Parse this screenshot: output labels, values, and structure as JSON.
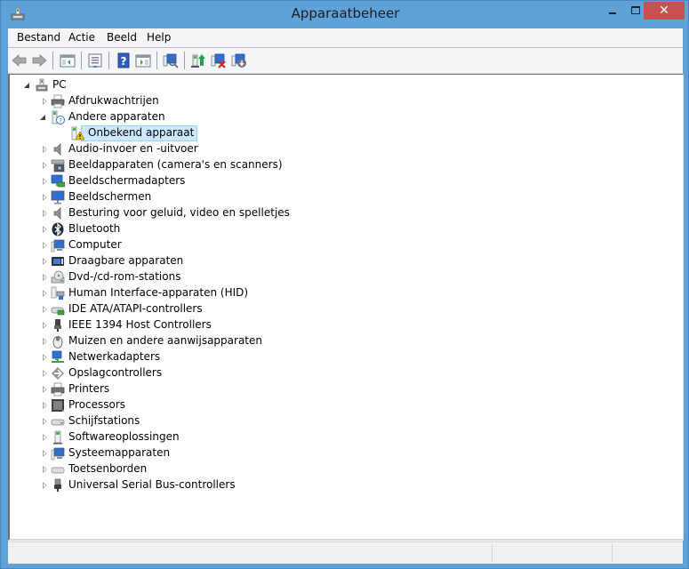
{
  "window": {
    "title": "Apparaatbeheer",
    "close_glyph": "✕",
    "icons": {
      "app": "device-manager-icon",
      "minimize": "minimize-icon",
      "maximize": "maximize-icon",
      "close": "close-icon"
    }
  },
  "menu": {
    "items": [
      {
        "label": "Bestand"
      },
      {
        "label": "Actie"
      },
      {
        "label": "Beeld"
      },
      {
        "label": "Help"
      }
    ]
  },
  "toolbar": {
    "buttons": [
      {
        "name": "back",
        "icon": "back-arrow-icon"
      },
      {
        "name": "forward",
        "icon": "forward-arrow-icon"
      },
      {
        "name": "show-hide-console-tree",
        "icon": "console-tree-icon"
      },
      {
        "name": "properties",
        "icon": "properties-icon"
      },
      {
        "name": "help",
        "icon": "help-icon"
      },
      {
        "name": "show-hide-action-pane",
        "icon": "action-pane-icon"
      },
      {
        "name": "scan-hardware-changes",
        "icon": "scan-hardware-icon"
      },
      {
        "name": "update-driver",
        "icon": "update-driver-icon"
      },
      {
        "name": "uninstall-device",
        "icon": "uninstall-device-icon"
      },
      {
        "name": "enable-device",
        "icon": "enable-device-icon"
      }
    ]
  },
  "tree": {
    "root": {
      "label": "PC",
      "icon": "computer-tower-icon",
      "expanded": true
    },
    "categories": [
      {
        "label": "Afdrukwachtrijen",
        "icon": "print-queue-icon",
        "expanded": false
      },
      {
        "label": "Andere apparaten",
        "icon": "unknown-device-icon",
        "expanded": true,
        "children": [
          {
            "label": "Onbekend apparaat",
            "icon": "warning-device-icon",
            "selected": true
          }
        ]
      },
      {
        "label": "Audio-invoer en -uitvoer",
        "icon": "speaker-icon",
        "expanded": false
      },
      {
        "label": "Beeldapparaten (camera's en scanners)",
        "icon": "camera-scanner-icon",
        "expanded": false
      },
      {
        "label": "Beeldschermadapters",
        "icon": "display-adapter-icon",
        "expanded": false
      },
      {
        "label": "Beeldschermen",
        "icon": "monitor-icon",
        "expanded": false
      },
      {
        "label": "Besturing voor geluid, video en spelletjes",
        "icon": "sound-icon",
        "expanded": false
      },
      {
        "label": "Bluetooth",
        "icon": "bluetooth-icon",
        "expanded": false
      },
      {
        "label": "Computer",
        "icon": "computer-icon",
        "expanded": false
      },
      {
        "label": "Draagbare apparaten",
        "icon": "portable-device-icon",
        "expanded": false
      },
      {
        "label": "Dvd-/cd-rom-stations",
        "icon": "dvd-drive-icon",
        "expanded": false
      },
      {
        "label": "Human Interface-apparaten (HID)",
        "icon": "hid-icon",
        "expanded": false
      },
      {
        "label": "IDE ATA/ATAPI-controllers",
        "icon": "ide-controller-icon",
        "expanded": false
      },
      {
        "label": "IEEE 1394 Host Controllers",
        "icon": "firewire-icon",
        "expanded": false
      },
      {
        "label": "Muizen en andere aanwijsapparaten",
        "icon": "mouse-icon",
        "expanded": false
      },
      {
        "label": "Netwerkadapters",
        "icon": "network-adapter-icon",
        "expanded": false
      },
      {
        "label": "Opslagcontrollers",
        "icon": "storage-controller-icon",
        "expanded": false
      },
      {
        "label": "Printers",
        "icon": "printer-icon",
        "expanded": false
      },
      {
        "label": "Processors",
        "icon": "processor-icon",
        "expanded": false
      },
      {
        "label": "Schijfstations",
        "icon": "disk-drive-icon",
        "expanded": false
      },
      {
        "label": "Softwareoplossingen",
        "icon": "software-component-icon",
        "expanded": false
      },
      {
        "label": "Systeemapparaten",
        "icon": "system-device-icon",
        "expanded": false
      },
      {
        "label": "Toetsenborden",
        "icon": "keyboard-icon",
        "expanded": false
      },
      {
        "label": "Universal Serial Bus-controllers",
        "icon": "usb-icon",
        "expanded": false
      }
    ]
  },
  "statusbar": {
    "panes": [
      "",
      "",
      ""
    ]
  }
}
